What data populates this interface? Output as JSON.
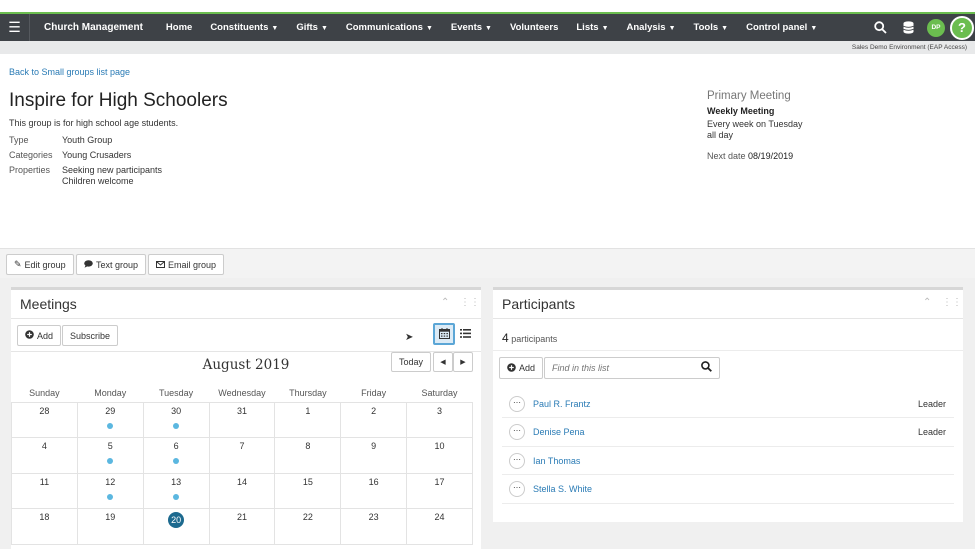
{
  "nav": {
    "brand": "Church Management",
    "items": [
      {
        "label": "Home",
        "caret": false
      },
      {
        "label": "Constituents",
        "caret": true
      },
      {
        "label": "Gifts",
        "caret": true
      },
      {
        "label": "Communications",
        "caret": true
      },
      {
        "label": "Events",
        "caret": true
      },
      {
        "label": "Volunteers",
        "caret": false
      },
      {
        "label": "Lists",
        "caret": true
      },
      {
        "label": "Analysis",
        "caret": true
      },
      {
        "label": "Tools",
        "caret": true
      },
      {
        "label": "Control panel",
        "caret": true
      }
    ],
    "avatar": "DP",
    "help": "?",
    "environment": "Sales Demo Environment (EAP Access)"
  },
  "group": {
    "back_link": "Back to Small groups list page",
    "title": "Inspire for High Schoolers",
    "description": "This group is for high school age students.",
    "type_label": "Type",
    "type_value": "Youth Group",
    "categories_label": "Categories",
    "categories_value": "Young Crusaders",
    "properties_label": "Properties",
    "properties_value_1": "Seeking new participants",
    "properties_value_2": "Children welcome"
  },
  "meeting": {
    "heading": "Primary Meeting",
    "name": "Weekly Meeting",
    "schedule": "Every week on Tuesday",
    "time": "all day",
    "next_label": "Next date",
    "next_date": "08/19/2019"
  },
  "actions": {
    "edit": "Edit group",
    "text": "Text group",
    "email": "Email group"
  },
  "meetings_panel": {
    "title": "Meetings",
    "add": "Add",
    "subscribe": "Subscribe",
    "month": "August 2019",
    "today": "Today",
    "weekdays": [
      "Sunday",
      "Monday",
      "Tuesday",
      "Wednesday",
      "Thursday",
      "Friday",
      "Saturday"
    ],
    "weeks": [
      [
        {
          "d": "28",
          "dot": false
        },
        {
          "d": "29",
          "dot": true
        },
        {
          "d": "30",
          "dot": true
        },
        {
          "d": "31",
          "dot": false
        },
        {
          "d": "1",
          "dot": false
        },
        {
          "d": "2",
          "dot": false
        },
        {
          "d": "3",
          "dot": false
        }
      ],
      [
        {
          "d": "4",
          "dot": false
        },
        {
          "d": "5",
          "dot": true
        },
        {
          "d": "6",
          "dot": true
        },
        {
          "d": "7",
          "dot": false
        },
        {
          "d": "8",
          "dot": false
        },
        {
          "d": "9",
          "dot": false
        },
        {
          "d": "10",
          "dot": false
        }
      ],
      [
        {
          "d": "11",
          "dot": false
        },
        {
          "d": "12",
          "dot": true
        },
        {
          "d": "13",
          "dot": true
        },
        {
          "d": "14",
          "dot": false
        },
        {
          "d": "15",
          "dot": false
        },
        {
          "d": "16",
          "dot": false
        },
        {
          "d": "17",
          "dot": false
        }
      ],
      [
        {
          "d": "18",
          "dot": false
        },
        {
          "d": "19",
          "dot": false
        },
        {
          "d": "20",
          "dot": false,
          "today": true
        },
        {
          "d": "21",
          "dot": false
        },
        {
          "d": "22",
          "dot": false
        },
        {
          "d": "23",
          "dot": false
        },
        {
          "d": "24",
          "dot": false
        }
      ]
    ]
  },
  "participants_panel": {
    "title": "Participants",
    "count": "4",
    "count_label": "participants",
    "add": "Add",
    "search_placeholder": "Find in this list",
    "rows": [
      {
        "name": "Paul R. Frantz",
        "role": "Leader"
      },
      {
        "name": "Denise Pena",
        "role": "Leader"
      },
      {
        "name": "Ian Thomas",
        "role": ""
      },
      {
        "name": "Stella S. White",
        "role": ""
      }
    ]
  },
  "colors": {
    "nav_bg": "#3e4247",
    "accent_green": "#6bbd4f",
    "link_blue": "#2a7bb5",
    "event_dot": "#5bb7e0",
    "today_circle": "#1d6a8f"
  }
}
